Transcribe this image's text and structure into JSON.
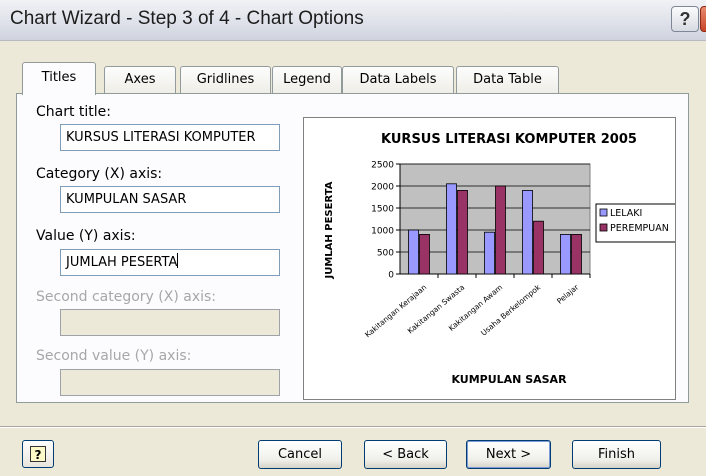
{
  "window": {
    "title": "Chart Wizard - Step 3 of 4 - Chart Options",
    "help_glyph": "?",
    "close_glyph": "X"
  },
  "tabs": [
    {
      "label": "Titles",
      "active": true
    },
    {
      "label": "Axes",
      "active": false
    },
    {
      "label": "Gridlines",
      "active": false
    },
    {
      "label": "Legend",
      "active": false
    },
    {
      "label": "Data Labels",
      "active": false
    },
    {
      "label": "Data Table",
      "active": false
    }
  ],
  "form": {
    "chart_title_label": "Chart title:",
    "chart_title_value": "KURSUS LITERASI KOMPUTER",
    "category_x_label": "Category (X) axis:",
    "category_x_value": "KUMPULAN SASAR",
    "value_y_label": "Value (Y) axis:",
    "value_y_value": "JUMLAH PESERTA",
    "second_category_label": "Second category (X) axis:",
    "second_category_value": "",
    "second_value_label": "Second value (Y) axis:",
    "second_value_value": ""
  },
  "buttons": {
    "cancel": "Cancel",
    "back": "< Back",
    "next": "Next >",
    "finish": "Finish"
  },
  "chart_data": {
    "type": "bar",
    "title": "KURSUS LITERASI KOMPUTER 2005",
    "xlabel": "KUMPULAN SASAR",
    "ylabel": "JUMLAH PESERTA",
    "categories": [
      "Kakitangan Kerajaan",
      "Kakitangan Swasta",
      "Kakitangan Awam",
      "Usaha Berkelompok",
      "Pelajar"
    ],
    "ylim": [
      0,
      2500
    ],
    "yticks": [
      0,
      500,
      1000,
      1500,
      2000,
      2500
    ],
    "grid": true,
    "legend": "right",
    "series": [
      {
        "name": "LELAKI",
        "color": "#9999ff",
        "values": [
          1000,
          2050,
          950,
          1900,
          900
        ]
      },
      {
        "name": "PEREMPUAN",
        "color": "#993366",
        "values": [
          900,
          1900,
          2000,
          1200,
          900
        ]
      }
    ],
    "plot_bg": "#c0c0c0"
  }
}
